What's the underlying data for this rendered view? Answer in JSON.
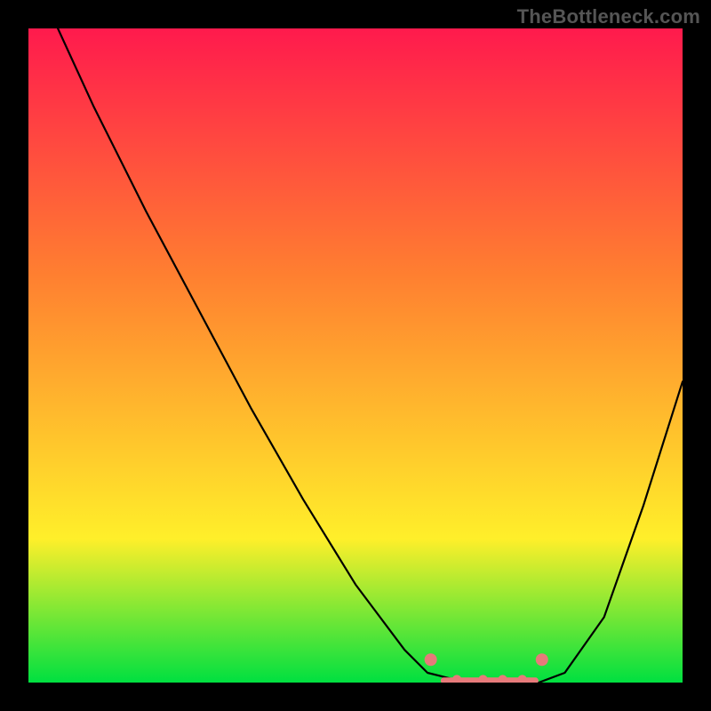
{
  "watermark": "TheBottleneck.com",
  "chart_data": {
    "type": "line",
    "title": "",
    "xlabel": "",
    "ylabel": "",
    "xlim": [
      0,
      1
    ],
    "ylim": [
      0,
      1
    ],
    "background_gradient": {
      "top": "#ff1a4d",
      "mid_upper": "#ff8030",
      "mid_lower": "#ffef2a",
      "bottom": "#00e040"
    },
    "series": [
      {
        "name": "bottleneck-curve",
        "x": [
          0.045,
          0.1,
          0.18,
          0.26,
          0.34,
          0.42,
          0.5,
          0.575,
          0.61,
          0.67,
          0.73,
          0.78,
          0.82,
          0.88,
          0.94,
          1.0
        ],
        "y": [
          1.0,
          0.88,
          0.72,
          0.57,
          0.42,
          0.28,
          0.15,
          0.05,
          0.015,
          0.0,
          0.0,
          0.0,
          0.015,
          0.1,
          0.27,
          0.46
        ]
      }
    ],
    "markers": {
      "name": "optimal-band",
      "x": [
        0.615,
        0.655,
        0.695,
        0.725,
        0.755,
        0.785
      ],
      "y": [
        0.035,
        0.005,
        0.005,
        0.005,
        0.005,
        0.035
      ]
    },
    "flat_segment": {
      "x0": 0.635,
      "x1": 0.775,
      "y": 0.003
    }
  }
}
